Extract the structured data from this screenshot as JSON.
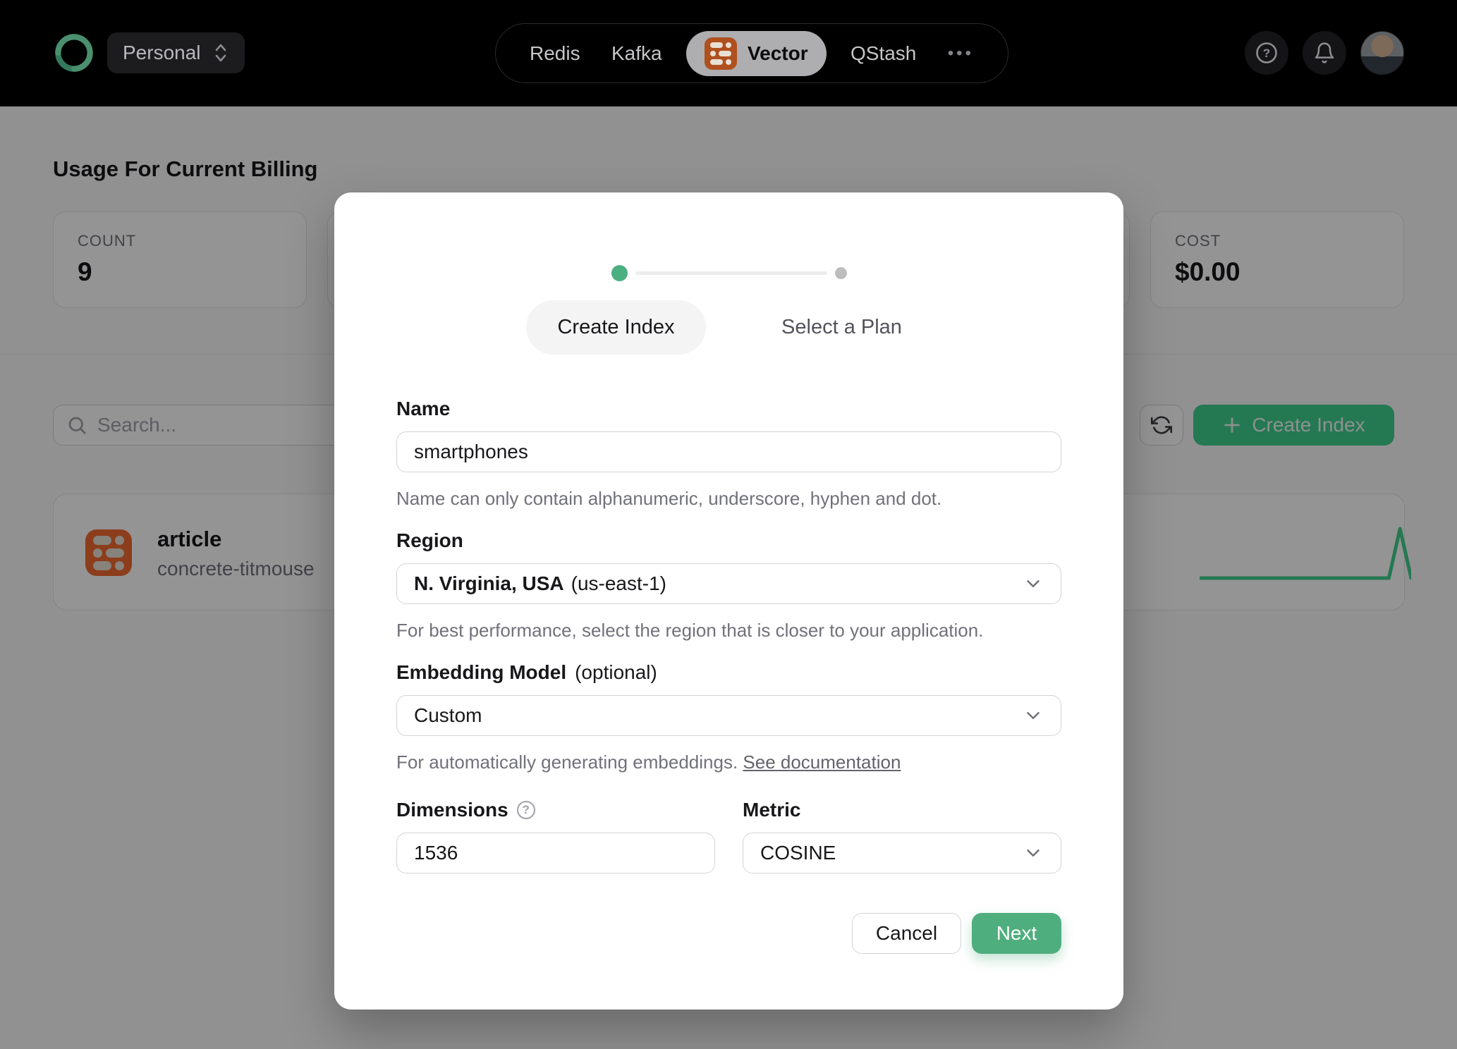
{
  "navbar": {
    "team": {
      "label": "Personal"
    },
    "products": [
      {
        "label": "Redis",
        "active": false
      },
      {
        "label": "Kafka",
        "active": false
      },
      {
        "label": "Vector",
        "active": true
      },
      {
        "label": "QStash",
        "active": false
      }
    ],
    "more_label": "•••"
  },
  "icons": {
    "logo": "upstash-spiral",
    "team_switcher": "chevrons-up-down",
    "vector_product": "database-rows",
    "help": "question-circle",
    "help_glyph": "?",
    "notifications": "bell",
    "search": "magnifier",
    "refresh": "circular-arrows",
    "plus": "plus",
    "dropdown": "chevron-down",
    "dimensions_help": "question-circle"
  },
  "page": {
    "heading": "Usage For Current Billing",
    "stats": [
      {
        "label": "COUNT",
        "value": "9"
      },
      {
        "label": "COST",
        "value": "$0.00"
      }
    ],
    "search": {
      "placeholder": "Search..."
    },
    "create_index_button": "Create Index",
    "index_list": [
      {
        "name": "article",
        "cluster": "concrete-titmouse",
        "sparkline": {
          "type": "line",
          "values": [
            0,
            0,
            0,
            0,
            0,
            0,
            0,
            0,
            0,
            0,
            0,
            0,
            0,
            0,
            0,
            0,
            0,
            0,
            9,
            0
          ],
          "color": "#3ecf8e"
        }
      }
    ]
  },
  "modal": {
    "stepper": {
      "current_step": 1,
      "total_steps": 2
    },
    "tabs": [
      {
        "label": "Create Index",
        "active": true
      },
      {
        "label": "Select a Plan",
        "active": false
      }
    ],
    "form": {
      "name": {
        "label": "Name",
        "value": "smartphones",
        "helper": "Name can only contain alphanumeric, underscore, hyphen and dot."
      },
      "region": {
        "label": "Region",
        "value": "N. Virginia, USA",
        "value_detail": "(us-east-1)",
        "helper": "For best performance, select the region that is closer to your application."
      },
      "embedding_model": {
        "label": "Embedding Model",
        "optional_suffix": "(optional)",
        "value": "Custom",
        "helper": "For automatically generating embeddings. ",
        "helper_link": "See documentation"
      },
      "dimensions": {
        "label": "Dimensions",
        "value": "1536"
      },
      "metric": {
        "label": "Metric",
        "value": "COSINE"
      }
    },
    "footer": {
      "cancel_label": "Cancel",
      "next_label": "Next"
    }
  },
  "colors": {
    "navbar_bg": "#000000",
    "accent_green": "#4fae7e",
    "stepper_active_green": "#4caf82",
    "brand_orange": "#f26a30",
    "spark_green": "#3ecf8e"
  }
}
